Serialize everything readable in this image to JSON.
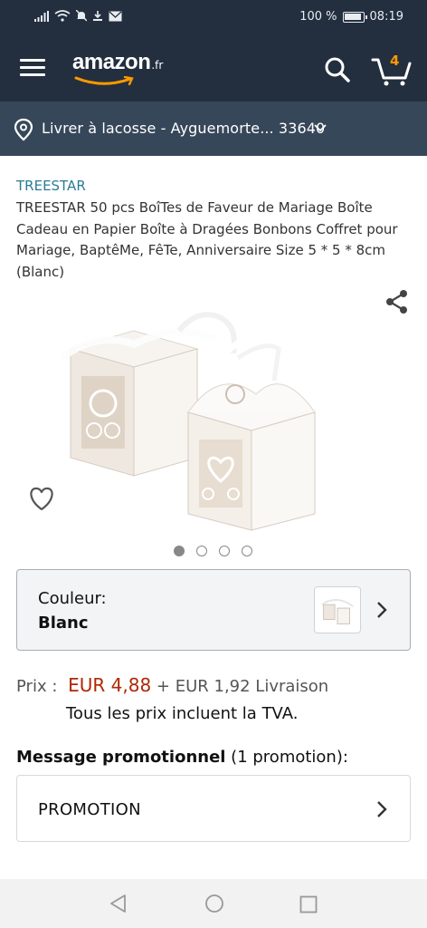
{
  "status_bar": {
    "battery_percent": "100 %",
    "time": "08:19"
  },
  "header": {
    "logo_text": "amazon",
    "logo_suffix": ".fr",
    "cart_count": "4"
  },
  "delivery": {
    "text": "Livrer à lacosse - Ayguemorte... 33640"
  },
  "product": {
    "brand": "TREESTAR",
    "title": "TREESTAR 50 pcs BoîTes de Faveur de Mariage Boîte Cadeau en Papier Boîte à Dragées Bonbons Coffret pour Mariage, BaptêMe, FêTe, Anniversaire Size 5 * 5 * 8cm (Blanc)",
    "image_count": 4,
    "active_image_index": 0
  },
  "variation": {
    "label": "Couleur:",
    "value": "Blanc"
  },
  "price": {
    "label": "Prix :",
    "value": "EUR 4,88",
    "shipping": "+ EUR 1,92 Livraison",
    "tax_note": "Tous les prix incluent la TVA."
  },
  "promotions": {
    "heading_bold": "Message promotionnel",
    "heading_rest": " (1 promotion):",
    "button_label": "PROMOTION"
  },
  "icons": {
    "menu": "hamburger-menu-icon",
    "search": "search-icon",
    "cart": "cart-icon",
    "location": "location-pin-icon",
    "share": "share-icon",
    "wishlist": "heart-icon"
  },
  "colors": {
    "header_bg": "#232f3e",
    "location_bg": "#37475a",
    "brand_link": "#2b7c94",
    "price": "#b12704",
    "accent": "#ff9900"
  }
}
